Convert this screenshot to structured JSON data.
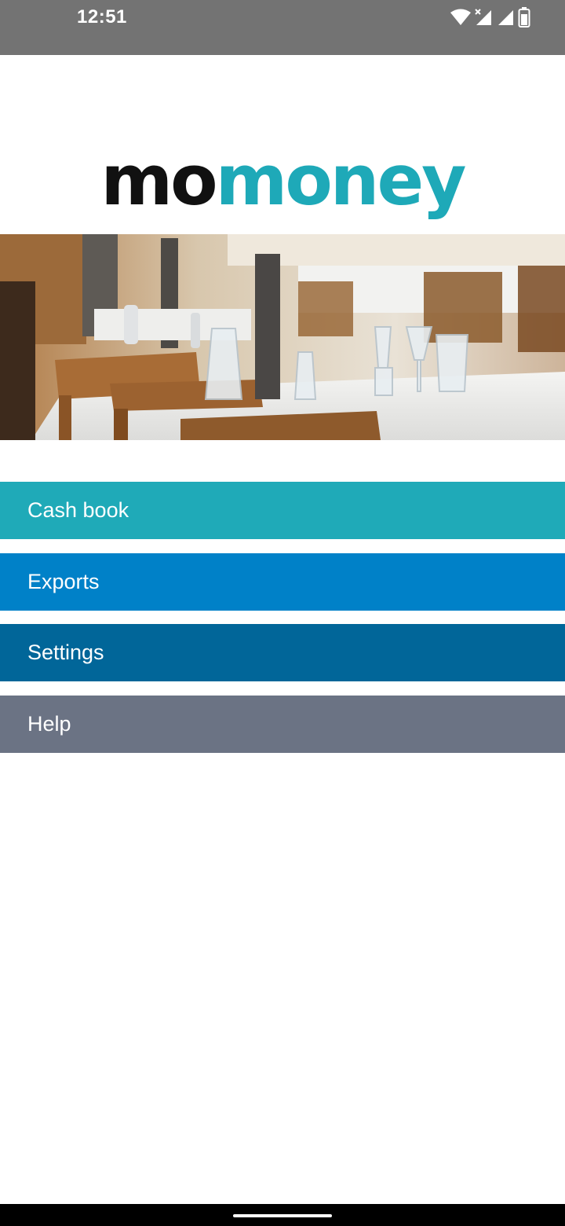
{
  "status_bar": {
    "time": "12:51",
    "icons": [
      "wifi-icon",
      "cell-signal-no-data-icon",
      "cell-signal-icon",
      "battery-icon"
    ]
  },
  "logo": {
    "part1": "mo",
    "part2": "money",
    "colors": {
      "part1": "#111111",
      "part2": "#1ea9b8"
    }
  },
  "hero": {
    "description_icon": "restaurant-photo"
  },
  "menu": {
    "items": [
      {
        "label": "Cash book",
        "color": "#1faab8"
      },
      {
        "label": "Exports",
        "color": "#0081c8"
      },
      {
        "label": "Settings",
        "color": "#016699"
      },
      {
        "label": "Help",
        "color": "#6b7384"
      }
    ]
  },
  "nav_bar": {
    "icons": [
      "home-gesture-pill"
    ]
  }
}
